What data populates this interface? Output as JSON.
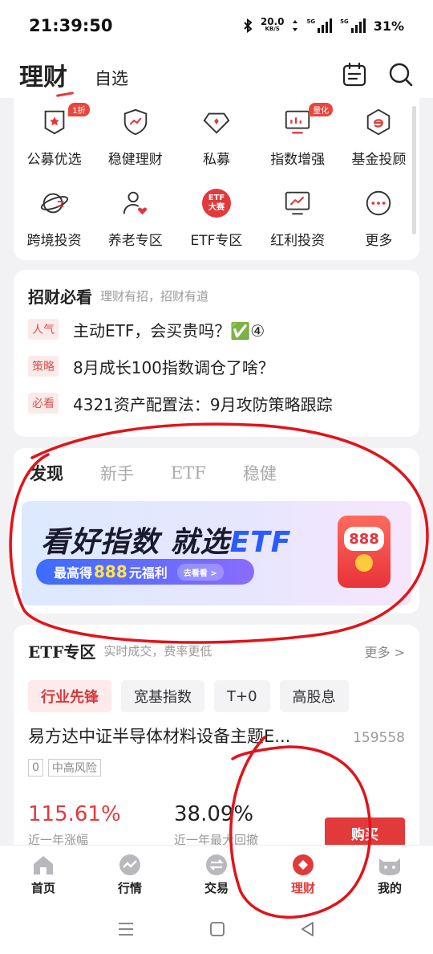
{
  "status": {
    "time": "21:39:50",
    "net_speed": "20.0",
    "net_unit": "KB/S",
    "sim1": "5G",
    "sim2": "5G",
    "battery": "31%"
  },
  "header": {
    "brand": "理财",
    "tab": "自选"
  },
  "grid": {
    "items": [
      {
        "label": "公募优选",
        "icon": "shield-star-icon",
        "badge": "1折"
      },
      {
        "label": "稳健理财",
        "icon": "shield-trend-icon"
      },
      {
        "label": "私募",
        "icon": "diamond-icon"
      },
      {
        "label": "指数增强",
        "icon": "monitor-chart-icon",
        "badge": "量化"
      },
      {
        "label": "基金投顾",
        "icon": "e-badge-icon"
      },
      {
        "label": "跨境投资",
        "icon": "globe-exchange-icon"
      },
      {
        "label": "养老专区",
        "icon": "person-heart-icon"
      },
      {
        "label": "ETF专区",
        "icon": "etf-contest-icon",
        "badge_top": "ETF",
        "badge_bottom": "大赛"
      },
      {
        "label": "红利投资",
        "icon": "monitor-trend-icon"
      },
      {
        "label": "更多",
        "icon": "more-dots-icon"
      }
    ]
  },
  "must_read": {
    "title": "招财必看",
    "subtitle": "理财有招，招财有道",
    "items": [
      {
        "tag": "人气",
        "text": "主动ETF，会买贵吗？✅④"
      },
      {
        "tag": "策略",
        "text": "8月成长100指数调仓了啥？"
      },
      {
        "tag": "必看",
        "text": "4321资产配置法：9月攻防策略跟踪"
      }
    ]
  },
  "discover": {
    "tabs": [
      "发现",
      "新手",
      "ETF",
      "稳健"
    ],
    "banner": {
      "headline_a": "看好指数 ",
      "headline_b": "就选",
      "headline_c": "ETF",
      "pill_pre": "最高得",
      "pill_num": "888",
      "pill_post": "元福利",
      "pill_btn": "去看看 >",
      "packet_num": "888"
    }
  },
  "etf_zone": {
    "title": "ETF专区",
    "subtitle": "实时成交，费率更低",
    "more": "更多 >",
    "chips": [
      "行业先锋",
      "宽基指数",
      "T+0",
      "高股息"
    ],
    "fund": {
      "name": "易方达中证半导体材料设备主题E...",
      "code": "159558",
      "tag_num": "0",
      "risk": "中高风险",
      "ret_value": "115.61%",
      "ret_label": "近一年涨幅",
      "dd_value": "38.09%",
      "dd_label": "近一年最大回撤",
      "buy": "购买"
    }
  },
  "bottom_nav": [
    {
      "label": "首页",
      "icon": "home-icon"
    },
    {
      "label": "行情",
      "icon": "market-icon"
    },
    {
      "label": "交易",
      "icon": "trade-icon"
    },
    {
      "label": "理财",
      "icon": "wealth-icon",
      "active": true
    },
    {
      "label": "我的",
      "icon": "profile-icon"
    }
  ],
  "colors": {
    "accent": "#e23a3a",
    "annotation": "#e0141a"
  }
}
